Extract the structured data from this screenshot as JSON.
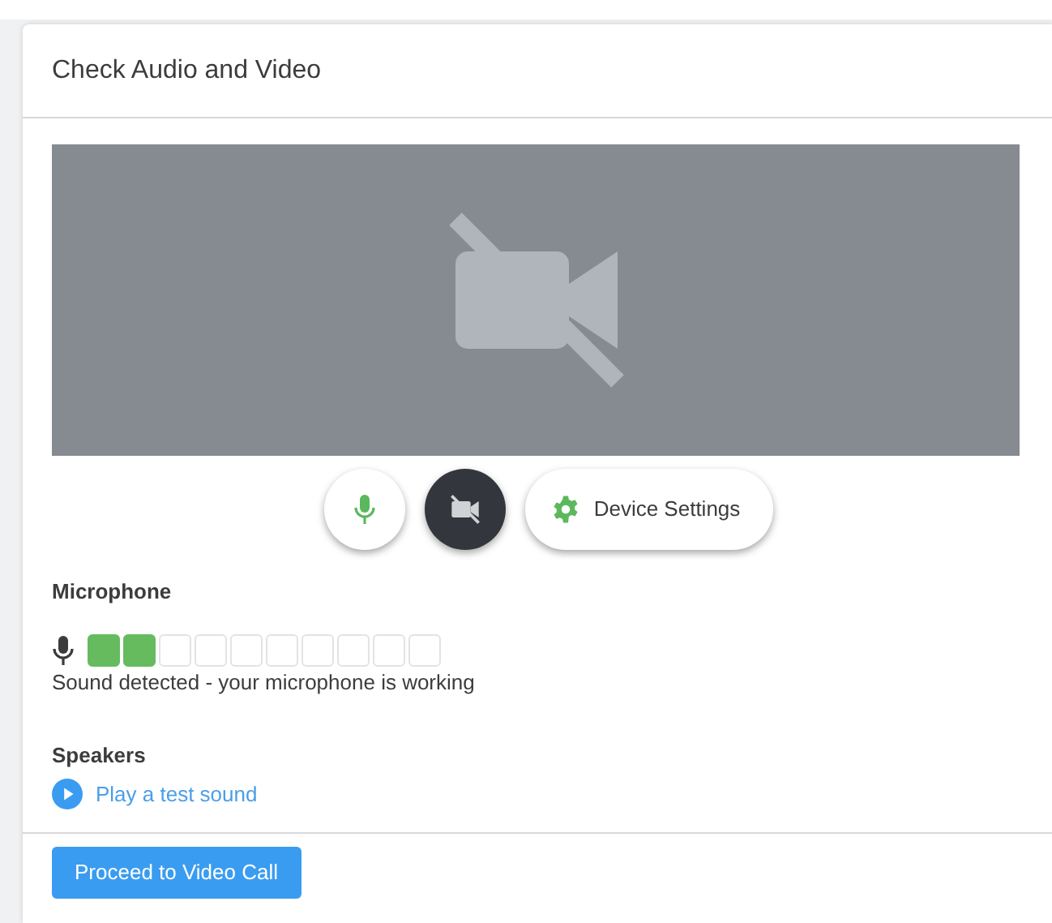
{
  "card": {
    "title": "Check Audio and Video"
  },
  "video": {
    "camera_on": false
  },
  "controls": {
    "mic_on": true,
    "camera_on": false,
    "settings_label": "Device Settings"
  },
  "microphone": {
    "heading": "Microphone",
    "segments": [
      {
        "on": true
      },
      {
        "on": true
      },
      {
        "on": false
      },
      {
        "on": false
      },
      {
        "on": false
      },
      {
        "on": false
      },
      {
        "on": false
      },
      {
        "on": false
      },
      {
        "on": false
      },
      {
        "on": false
      }
    ],
    "status": "Sound detected - your microphone is working"
  },
  "speakers": {
    "heading": "Speakers",
    "link": "Play a test sound"
  },
  "footer": {
    "button": "Proceed to Video Call"
  }
}
